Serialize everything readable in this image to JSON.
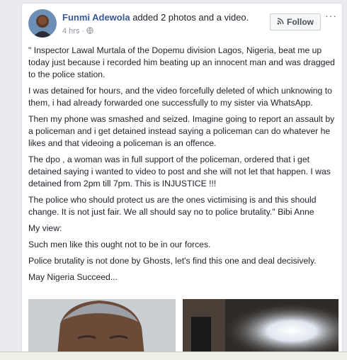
{
  "post": {
    "author": "Funmi Adewola",
    "action": " added 2 photos and a video.",
    "time": "4 hrs",
    "separator": "·",
    "follow_label": "Follow",
    "more_label": "···",
    "paragraphs": [
      "\" Inspector Lawal Murtala of the Dopemu division Lagos, Nigeria, beat me up today just because i recorded him beating up an innocent man and was dragged to the police station.",
      "I was detained for hours, and the video forcefully deleted of which unknowing to them, i had already forwarded one successfully to my sister via WhatsApp.",
      "Then my phone was smashed and seized. Imagine going to report an assault by a policeman and i get detained instead saying a policeman can do whatever he likes and that videoing a policeman is an offence.",
      "The dpo , a woman was in full support of the policeman, ordered that i get detained saying i wanted to video to post and she will not let that happen. I was detained from 2pm till 7pm. This is INJUSTICE !!!",
      "The police who should protect us are the ones victimising is and this should change. It is not just fair. We all should say no to police brutality.\" Bibi Anne",
      "My view:",
      "Such men like this ought not to be in our forces.",
      "Police brutality is not done by Ghosts, let's find this one and deal decisively.",
      "May Nigeria Succeed..."
    ]
  },
  "icons": {
    "privacy": "globe-icon",
    "follow": "rss-icon",
    "more": "more-icon"
  },
  "colors": {
    "author": "#385898",
    "text": "#1d2129",
    "meta": "#90949c",
    "background": "#e9ebee"
  }
}
